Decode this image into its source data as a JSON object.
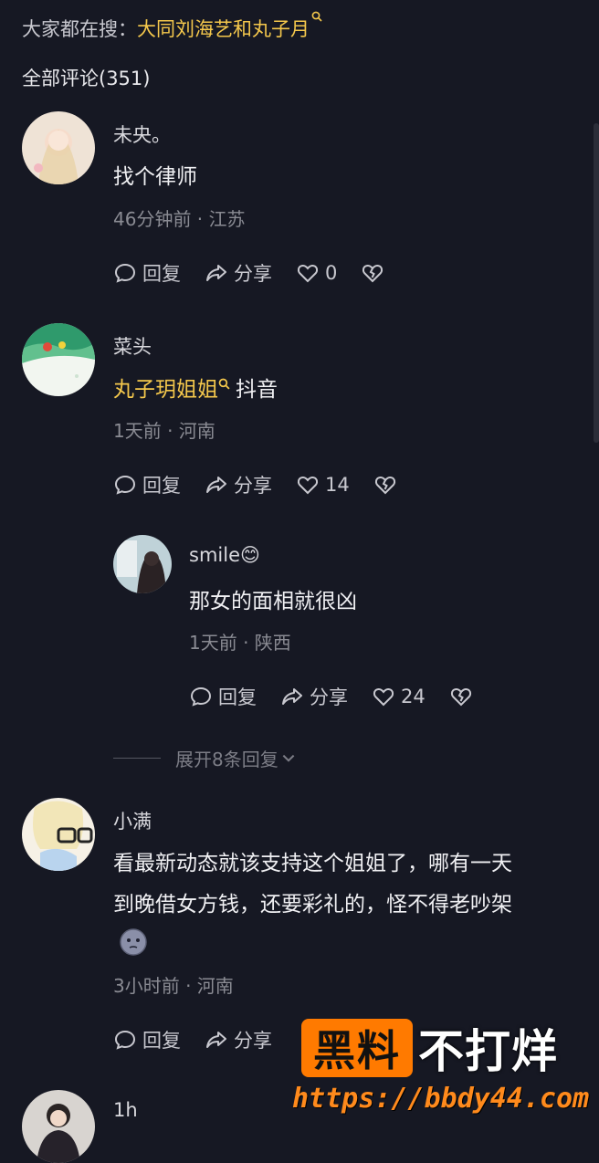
{
  "top": {
    "search_prefix": "大家都在搜：",
    "search_keyword": "大同刘海艺和丸子月"
  },
  "comments_count": "全部评论(351)",
  "comments": [
    {
      "user": "未央。",
      "text": "找个律师",
      "meta": "46分钟前 · 江苏",
      "reply": "回复",
      "share": "分享",
      "likes": "0"
    },
    {
      "user": "菜头",
      "text_highlight": "丸子玥姐姐",
      "text_after": "抖音",
      "meta": "1天前 · 河南",
      "reply": "回复",
      "share": "分享",
      "likes": "14"
    },
    {
      "user": "smile😊",
      "text": "那女的面相就很凶",
      "meta": "1天前 · 陕西",
      "reply": "回复",
      "share": "分享",
      "likes": "24"
    },
    {
      "user": "小满",
      "text_line1": "看最新动态就该支持这个姐姐了，哪有一天",
      "text_line2": "到晚借女方钱，还要彩礼的，怪不得老吵架",
      "meta": "3小时前 · 河南",
      "reply": "回复",
      "share": "分享"
    },
    {
      "user": "1h"
    }
  ],
  "expand_replies": "展开8条回复",
  "watermark": {
    "badge": "黑料",
    "text": "不打烊",
    "url": "https://bbdy44.com"
  }
}
